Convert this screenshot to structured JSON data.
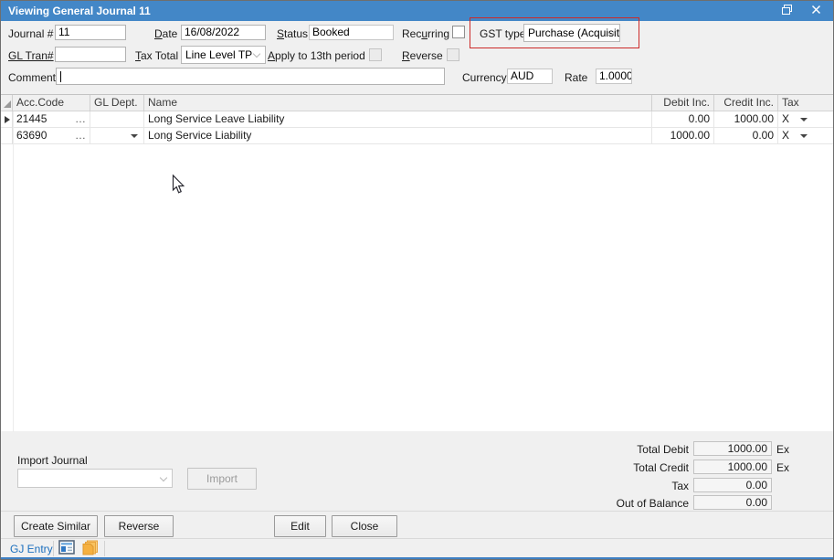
{
  "window": {
    "title": "Viewing General Journal 11"
  },
  "form": {
    "journal_label": "Journal #",
    "journal_value": "11",
    "date_label_u": "D",
    "date_label_rest": "ate",
    "date_value": "16/08/2022",
    "status_label_u": "S",
    "status_label_rest": "tatus",
    "status_value": "Booked",
    "recurring_pre": "Rec",
    "recurring_u": "u",
    "recurring_rest": "rring",
    "gst_label": "GST type",
    "gst_value": "Purchase (Acquisitio",
    "gl_tran_label": "GL Tran#",
    "gl_tran_value": "",
    "tax_total_u": "T",
    "tax_total_rest": "ax Total",
    "tax_total_value": "Line Level TP",
    "apply13_u": "A",
    "apply13_rest": "pply to 13th period",
    "reverse_u": "R",
    "reverse_rest": "everse",
    "comment_label": "Comment",
    "comment_value": "",
    "currency_label": "Currency",
    "currency_value": "AUD",
    "rate_label": "Rate",
    "rate_value": "1.0000"
  },
  "grid": {
    "columns": [
      "Acc.Code",
      "GL Dept.",
      "Name",
      "Debit Inc.",
      "Credit Inc.",
      "Tax"
    ],
    "ellipsis": "…",
    "rows": [
      {
        "acc_code": "21445",
        "gl_dept": "",
        "name": "Long Service Leave Liability",
        "debit": "0.00",
        "credit": "1000.00",
        "tax": "X"
      },
      {
        "acc_code": "63690",
        "gl_dept": "",
        "name": "Long Service Liability",
        "debit": "1000.00",
        "credit": "0.00",
        "tax": "X"
      }
    ]
  },
  "totals": {
    "total_debit_label": "Total Debit",
    "total_debit_value": "1000.00",
    "total_debit_suffix": "Ex",
    "total_credit_label": "Total Credit",
    "total_credit_value": "1000.00",
    "total_credit_suffix": "Ex",
    "tax_label": "Tax",
    "tax_value": "0.00",
    "oob_label": "Out of Balance",
    "oob_value": "0.00"
  },
  "import_section": {
    "label": "Import Journal",
    "combo_value": "",
    "button_label": "Import"
  },
  "buttons": {
    "create_similar": "Create Similar",
    "reverse": "Reverse",
    "edit": "Edit",
    "close": "Close"
  },
  "statusbar": {
    "tab_label": "GJ Entry"
  },
  "colors": {
    "titlebar_blue": "#4387c7",
    "highlight_red": "#cc2a29",
    "status_tab_blue": "#1b6fbe",
    "bottom_strip_blue": "#3e80c4"
  }
}
